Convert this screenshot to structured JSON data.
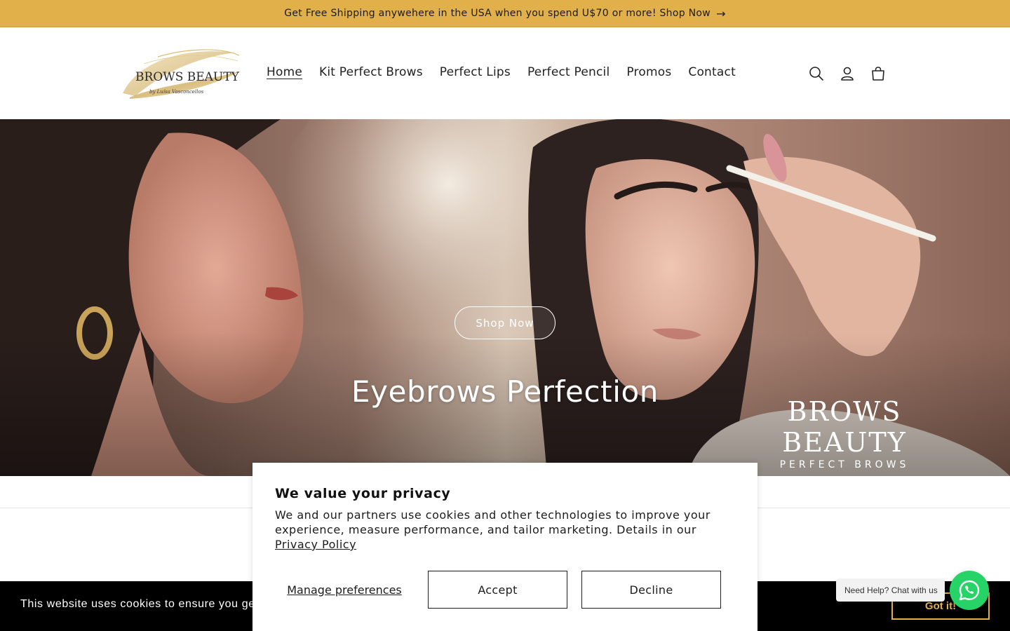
{
  "announcement": {
    "text": "Get Free Shipping anywehere in the USA when you spend U$70 or more! Shop Now",
    "arrow_icon": "arrow-right-icon"
  },
  "header": {
    "logo": {
      "brand": "BROWS BEAUTY",
      "tagline": "by Luísa Vasconcellos"
    },
    "nav": [
      {
        "label": "Home",
        "active": true
      },
      {
        "label": "Kit Perfect Brows",
        "active": false
      },
      {
        "label": "Perfect Lips",
        "active": false
      },
      {
        "label": "Perfect Pencil",
        "active": false
      },
      {
        "label": "Promos",
        "active": false
      },
      {
        "label": "Contact",
        "active": false
      }
    ],
    "icons": [
      "search-icon",
      "account-icon",
      "cart-icon"
    ]
  },
  "hero": {
    "title": "Eyebrows Perfection",
    "button_label": "Shop Now",
    "brand_line1": "BROWS BEAUTY",
    "brand_line2": "PERFECT BROWS"
  },
  "privacy": {
    "title": "We value your privacy",
    "body": "We and our partners use cookies and other technologies to improve your experience, measure performance, and tailor marketing. Details in our",
    "policy_link": "Privacy Policy",
    "manage_label": "Manage preferences",
    "accept_label": "Accept",
    "decline_label": "Decline"
  },
  "cookie_bar": {
    "text": "This website uses cookies to ensure you ge",
    "got_it_label": "Got it!"
  },
  "whatsapp": {
    "tooltip": "Need Help? Chat with us",
    "icon": "whatsapp-icon"
  },
  "colors": {
    "announcement_bg": "#e2b04a",
    "whatsapp_green": "#25d366",
    "cookie_bar_bg": "#000000"
  }
}
